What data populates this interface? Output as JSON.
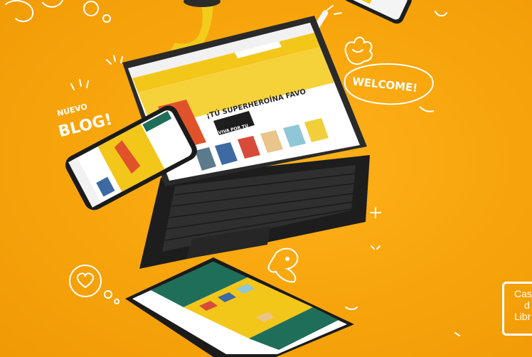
{
  "doodles": {
    "nuevo": "NUEVO",
    "blog": "BLOG!",
    "welcome": "WELCOME!"
  },
  "laptop": {
    "hero_headline": "¡TÚ SUPERHEROÍNA FAVO",
    "hero_badge": "VIVA POR TU"
  },
  "brand": {
    "line1": "Cas",
    "line2": "d",
    "line3": "Libr"
  },
  "colors": {
    "background": "#f7a40c",
    "site_yellow": "#f3c61a",
    "site_teal": "#1f6e5a",
    "device_dark": "#2b2b2b",
    "strap_yellow": "#f2cc1c"
  }
}
